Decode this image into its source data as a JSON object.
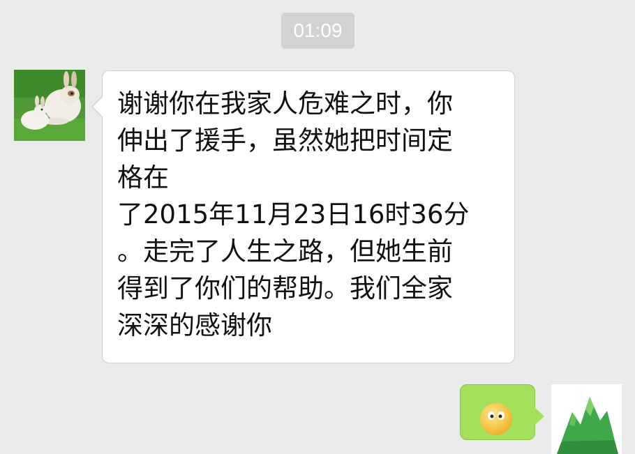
{
  "timestamp": "01:09",
  "incoming_message": {
    "avatar": "rabbit-photo-avatar",
    "lines": [
      "谢谢你在我家人危难之时，你",
      "伸出了援手，虽然她把时间定",
      "格在",
      "了2015年11月23日16时36分",
      "。走完了人生之路，但她生前",
      "得到了你们的帮助。我们全家",
      "深深的感谢你"
    ]
  },
  "outgoing_message": {
    "content": "emoji-face-icon",
    "avatar": "green-mountain-avatar"
  },
  "colors": {
    "background": "#ebebeb",
    "incoming_bubble": "#ffffff",
    "outgoing_bubble": "#a3e15a",
    "timestamp_pill": "#d2d2d2"
  }
}
